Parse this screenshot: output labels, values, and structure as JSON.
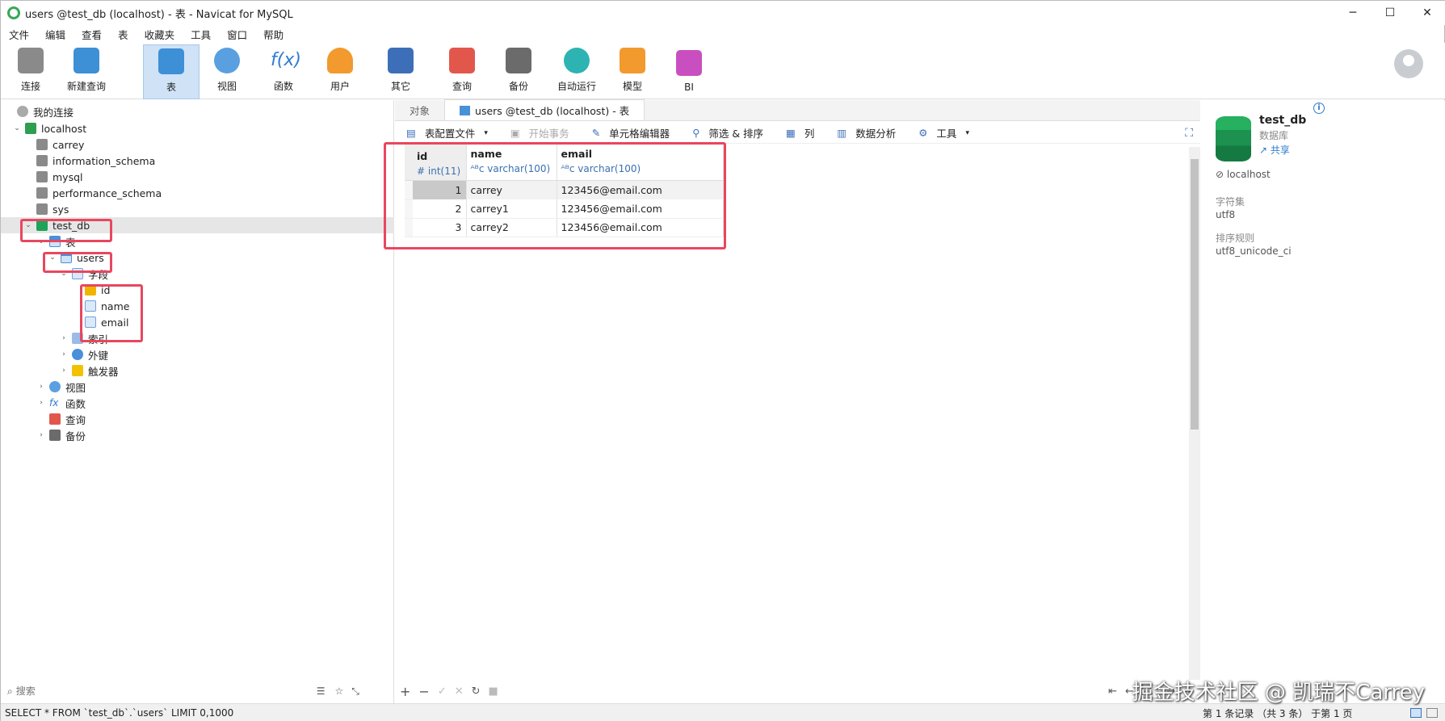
{
  "window": {
    "title": "users @test_db (localhost) - 表 - Navicat for MySQL"
  },
  "menu": [
    "文件",
    "编辑",
    "查看",
    "表",
    "收藏夹",
    "工具",
    "窗口",
    "帮助"
  ],
  "toolbar": {
    "connect": "连接",
    "new_query": "新建查询",
    "table": "表",
    "view": "视图",
    "function": "函数",
    "user": "用户",
    "other": "其它",
    "query": "查询",
    "backup": "备份",
    "auto_run": "自动运行",
    "model": "模型",
    "bi": "BI"
  },
  "tree": {
    "my_connections": "我的连接",
    "server": "localhost",
    "databases": [
      "carrey",
      "information_schema",
      "mysql",
      "performance_schema",
      "sys"
    ],
    "selected_db": "test_db",
    "tables_group": "表",
    "table": "users",
    "fields_group": "字段",
    "fields": [
      "id",
      "name",
      "email"
    ],
    "indexes": "索引",
    "foreign_keys": "外键",
    "triggers": "触发器",
    "views": "视图",
    "functions": "函数",
    "queries": "查询",
    "backups": "备份"
  },
  "search": {
    "placeholder": "搜索"
  },
  "tabs": {
    "objects": "对象",
    "current": "users @test_db (localhost) - 表"
  },
  "subtoolbar": {
    "profile": "表配置文件",
    "begin_tx": "开始事务",
    "cell_editor": "单元格编辑器",
    "filter_sort": "筛选 & 排序",
    "columns": "列",
    "data_analysis": "数据分析",
    "tools": "工具"
  },
  "grid": {
    "columns": [
      {
        "name": "id",
        "type": "int(11)"
      },
      {
        "name": "name",
        "type": "varchar(100)"
      },
      {
        "name": "email",
        "type": "varchar(100)"
      }
    ],
    "rows": [
      {
        "id": "1",
        "name": "carrey",
        "email": "123456@email.com"
      },
      {
        "id": "2",
        "name": "carrey1",
        "email": "123456@email.com"
      },
      {
        "id": "3",
        "name": "carrey2",
        "email": "123456@email.com"
      }
    ]
  },
  "pager": {
    "page": "1"
  },
  "info": {
    "db_name": "test_db",
    "db_kind": "数据库",
    "share": "共享",
    "host": "localhost",
    "charset_label": "字符集",
    "charset": "utf8",
    "collation_label": "排序规则",
    "collation": "utf8_unicode_ci"
  },
  "status": {
    "sql": "SELECT * FROM `test_db`.`users` LIMIT 0,1000",
    "records": "第 1 条记录 （共 3 条） 于第 1 页"
  },
  "watermark": "掘金技术社区 @ 凯瑞不Carrey",
  "colors": {
    "highlight": "#e8475f",
    "accent": "#1fa35a",
    "selection": "#cfe2f6"
  }
}
